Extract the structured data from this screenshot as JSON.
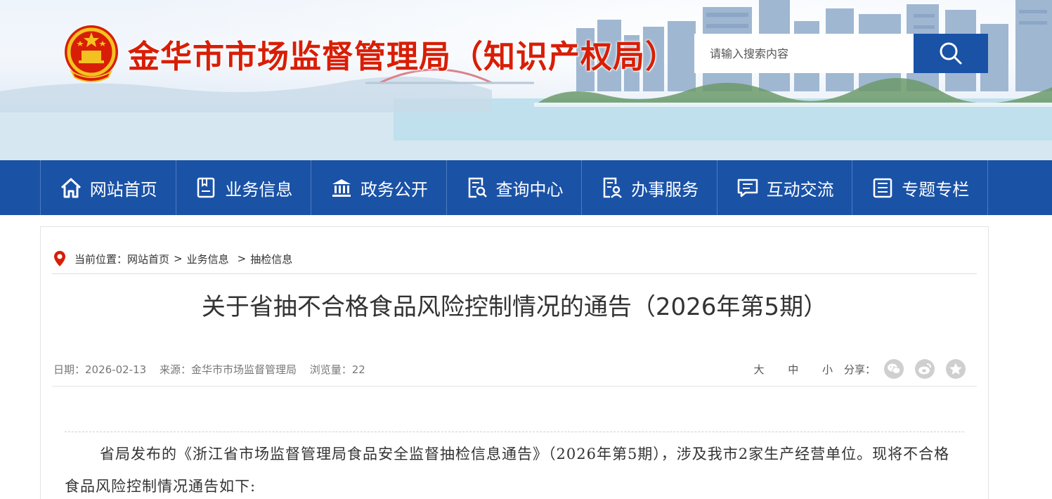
{
  "header": {
    "site_title": "金华市市场监督管理局（知识产权局）",
    "search_placeholder": "请输入搜索内容",
    "search_icon": "search-icon",
    "emblem_icon": "national-emblem-icon"
  },
  "nav": {
    "items": [
      {
        "label": "网站首页",
        "icon": "home-icon"
      },
      {
        "label": "业务信息",
        "icon": "document-icon"
      },
      {
        "label": "政务公开",
        "icon": "bank-icon"
      },
      {
        "label": "查询中心",
        "icon": "search-doc-icon"
      },
      {
        "label": "办事服务",
        "icon": "service-icon"
      },
      {
        "label": "互动交流",
        "icon": "chat-icon"
      },
      {
        "label": "专题专栏",
        "icon": "column-icon"
      }
    ]
  },
  "breadcrumb": {
    "prefix": "当前位置：",
    "items": [
      "网站首页",
      "业务信息",
      "抽检信息"
    ],
    "sep1": ">",
    "sep2": ">"
  },
  "article": {
    "title": "关于省抽不合格食品风险控制情况的通告（2026年第5期）",
    "date": "日期：2026-02-13",
    "source": "来源：金华市市场监督管理局",
    "views": "浏览量：22",
    "font_sizes": [
      "大",
      "中",
      "小"
    ],
    "share_label": "分享：",
    "share_icons": [
      "wechat-icon",
      "weibo-icon",
      "favorite-icon"
    ],
    "body": "省局发布的《浙江省市场监督管理局食品安全监督抽检信息通告》（2026年第5期），涉及我市2家生产经营单位。现将不合格食品风险控制情况通告如下:"
  },
  "colors": {
    "title_red": "#d81e06",
    "nav_blue": "#1a52a6"
  }
}
